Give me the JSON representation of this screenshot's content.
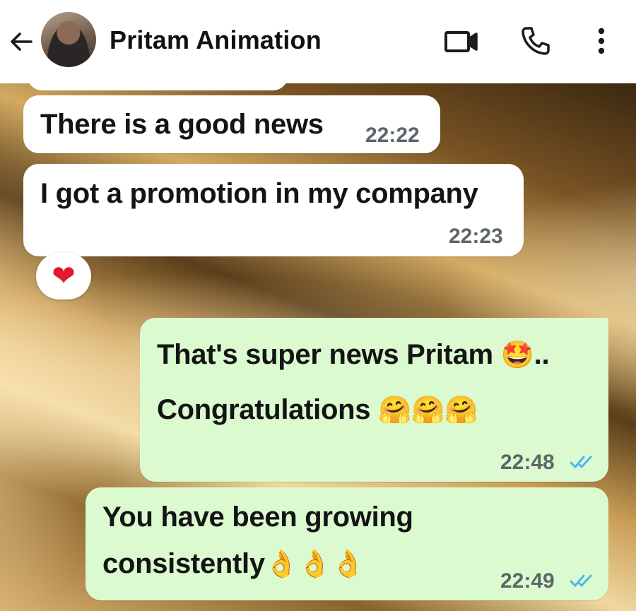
{
  "header": {
    "contact_name": "Pritam Animation",
    "icons": [
      "back-arrow-icon",
      "avatar",
      "video-call-icon",
      "voice-call-icon",
      "more-options-icon"
    ]
  },
  "messages": [
    {
      "direction": "incoming",
      "text": "There is a good news",
      "time": "22:22"
    },
    {
      "direction": "incoming",
      "text": "I got a promotion in my company",
      "time": "22:23",
      "reaction": "❤"
    },
    {
      "direction": "outgoing",
      "line1": "That's super news Pritam",
      "line1_emoji": "🤩",
      "line1_suffix": "..",
      "line2": "Congratulations",
      "line2_emoji": "🤗🤗🤗",
      "time": "22:48",
      "status": "read"
    },
    {
      "direction": "outgoing",
      "line1": "You have been growing",
      "line2": "consistently",
      "line2_emoji": "👌👌👌",
      "time": "22:49",
      "status": "read"
    }
  ],
  "colors": {
    "incoming_bubble": "#ffffff",
    "outgoing_bubble": "#dbfad0",
    "read_ticks": "#4fb6ec",
    "timestamp": "#5d6669"
  }
}
